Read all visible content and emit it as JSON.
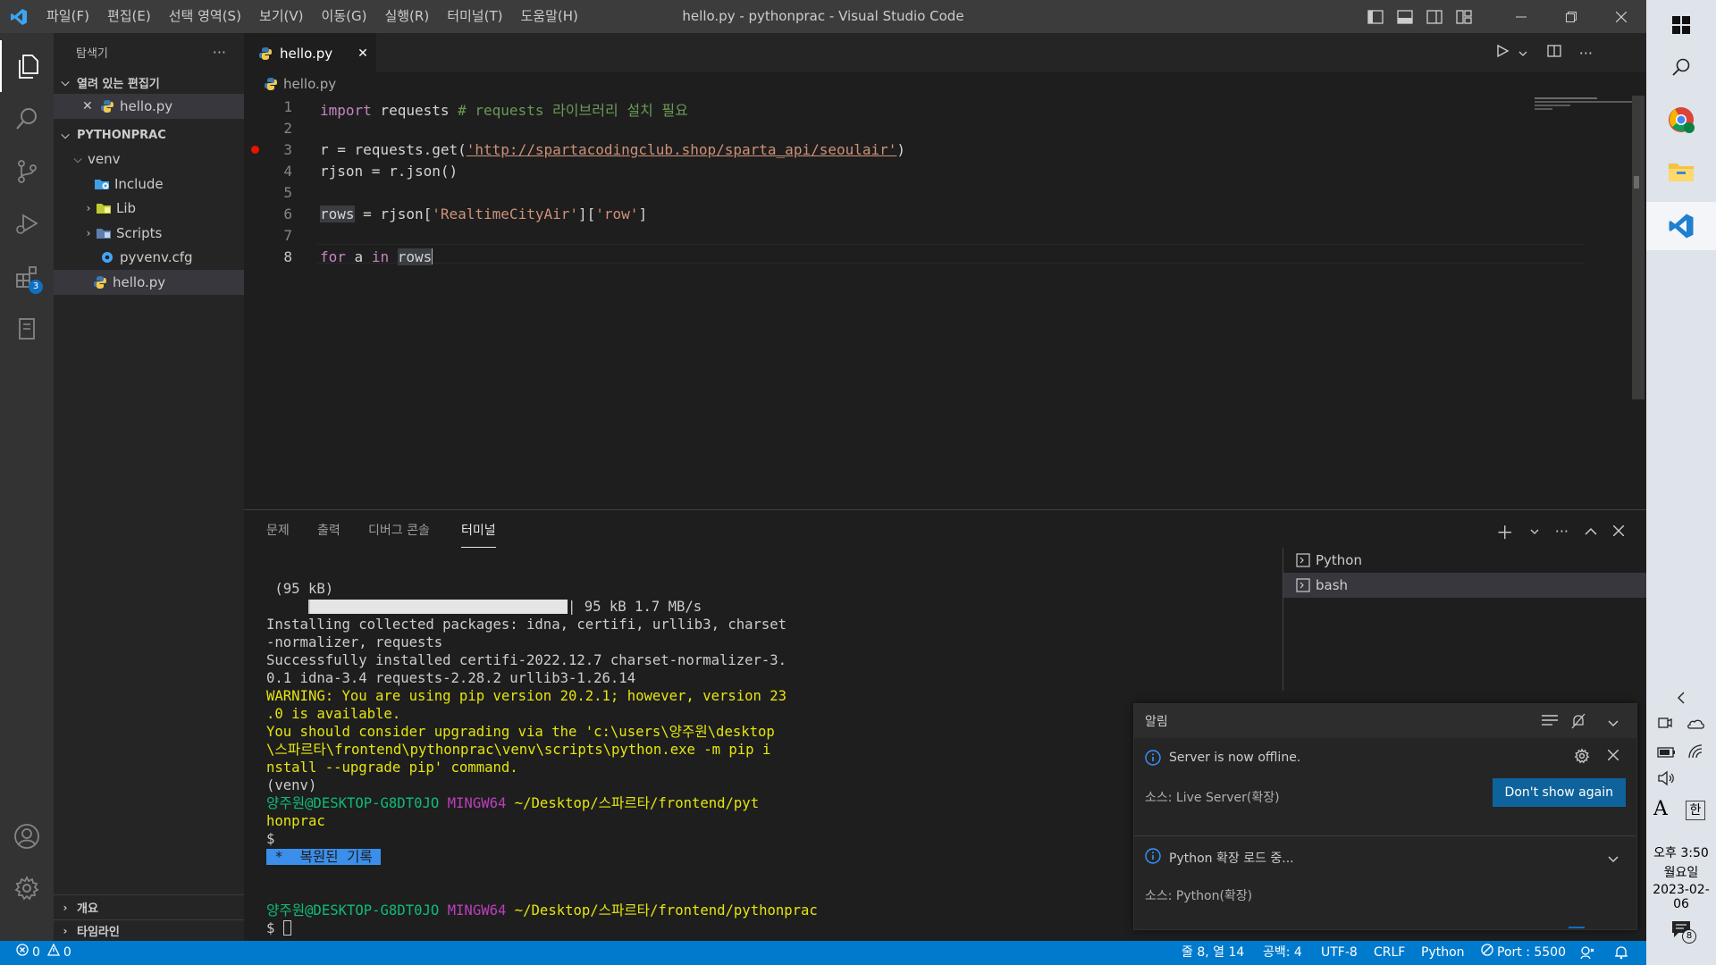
{
  "window": {
    "title": "hello.py - pythonprac - Visual Studio Code",
    "menu": [
      "파일(F)",
      "편집(E)",
      "선택 영역(S)",
      "보기(V)",
      "이동(G)",
      "실행(R)",
      "터미널(T)",
      "도움말(H)"
    ]
  },
  "activity": {
    "extensions_badge": "3"
  },
  "sidebar": {
    "title": "탐색기",
    "more": "···",
    "open_editors_header": "열려 있는 편집기",
    "open_editors": [
      {
        "close": "✕",
        "label": "hello.py"
      }
    ],
    "project_header": "PYTHONPRAC",
    "tree": {
      "venv": "venv",
      "include": "Include",
      "lib": "Lib",
      "scripts": "Scripts",
      "pyvenv": "pyvenv.cfg",
      "hello": "hello.py"
    },
    "outline_header": "개요",
    "timeline_header": "타임라인"
  },
  "editor": {
    "tab": {
      "label": "hello.py",
      "close": "✕"
    },
    "breadcrumb": "hello.py",
    "lines": {
      "n": [
        "1",
        "2",
        "3",
        "4",
        "5",
        "6",
        "7",
        "8"
      ],
      "l1": {
        "kw": "import",
        "t1": " requests ",
        "cm": "# requests 라이브러리 설치 필요"
      },
      "l3": {
        "t1": "r = requests.get(",
        "st": "'http://spartacodingclub.shop/sparta_api/seoulair'",
        "t2": ")"
      },
      "l4": "rjson = r.json()",
      "l6": {
        "hl": "rows",
        "t1": " = rjson[",
        "s1": "'RealtimeCityAir'",
        "t2": "][",
        "s2": "'row'",
        "t3": "]"
      },
      "l8": {
        "k1": "for",
        "t1": " a ",
        "k2": "in",
        "t2": " ",
        "hl": "rows"
      }
    }
  },
  "panel": {
    "tabs": [
      "문제",
      "출력",
      "디버그 콘솔",
      "터미널"
    ],
    "active_tab": "터미널",
    "terminal": {
      "t1": " (95 kB)",
      "t2_suffix": "| 95 kB 1.7 MB/s",
      "t3": "Installing collected packages: idna, certifi, urllib3, charset",
      "t4": "-normalizer, requests",
      "t5": "Successfully installed certifi-2022.12.7 charset-normalizer-3.",
      "t6": "0.1 idna-3.4 requests-2.28.2 urllib3-1.26.14",
      "w1": "WARNING: You are using pip version 20.2.1; however, version 23",
      "w2": ".0 is available.",
      "w3": "You should consider upgrading via the 'c:\\users\\양주원\\desktop",
      "w4": "\\스파르타\\frontend\\pythonprac\\venv\\scripts\\python.exe -m pip i",
      "w5": "nstall --upgrade pip' command.",
      "venv": "(venv)",
      "p1_user": "양주원@DESKTOP-G8DT0JO",
      "p1_sys": "MINGW64",
      "p1_path": "~/Desktop/스파르타/frontend/pyt",
      "p1_path2": "honprac",
      "dollar": "$",
      "restored": " *  복원된 기록 ",
      "p2_user": "양주원@DESKTOP-G8DT0JO",
      "p2_sys": "MINGW64",
      "p2_path": "~/Desktop/스파르타/frontend/pythonprac",
      "dollar2": "$ "
    },
    "terminal_list": [
      "Python",
      "bash"
    ]
  },
  "notifications": {
    "title": "알림",
    "items": [
      {
        "message": "Server is now offline.",
        "source": "소스: Live Server(확장)",
        "button": "Don't show again"
      },
      {
        "message": "Python 확장 로드 중...",
        "source": "소스: Python(확장)"
      }
    ]
  },
  "status": {
    "errors": "0",
    "warnings": "0",
    "position": "줄 8, 열 14",
    "spaces": "공백: 4",
    "encoding": "UTF-8",
    "eol": "CRLF",
    "language": "Python",
    "port": "Port : 5500"
  },
  "taskbar": {
    "ime_a": "A",
    "ime_han": "한",
    "time": "오후 3:50",
    "weekday": "월요일",
    "date": "2023-02-06",
    "notif_count": "8"
  },
  "colors": {
    "accent": "#007acc",
    "button": "#0e639c",
    "breakpoint": "#e51400"
  }
}
